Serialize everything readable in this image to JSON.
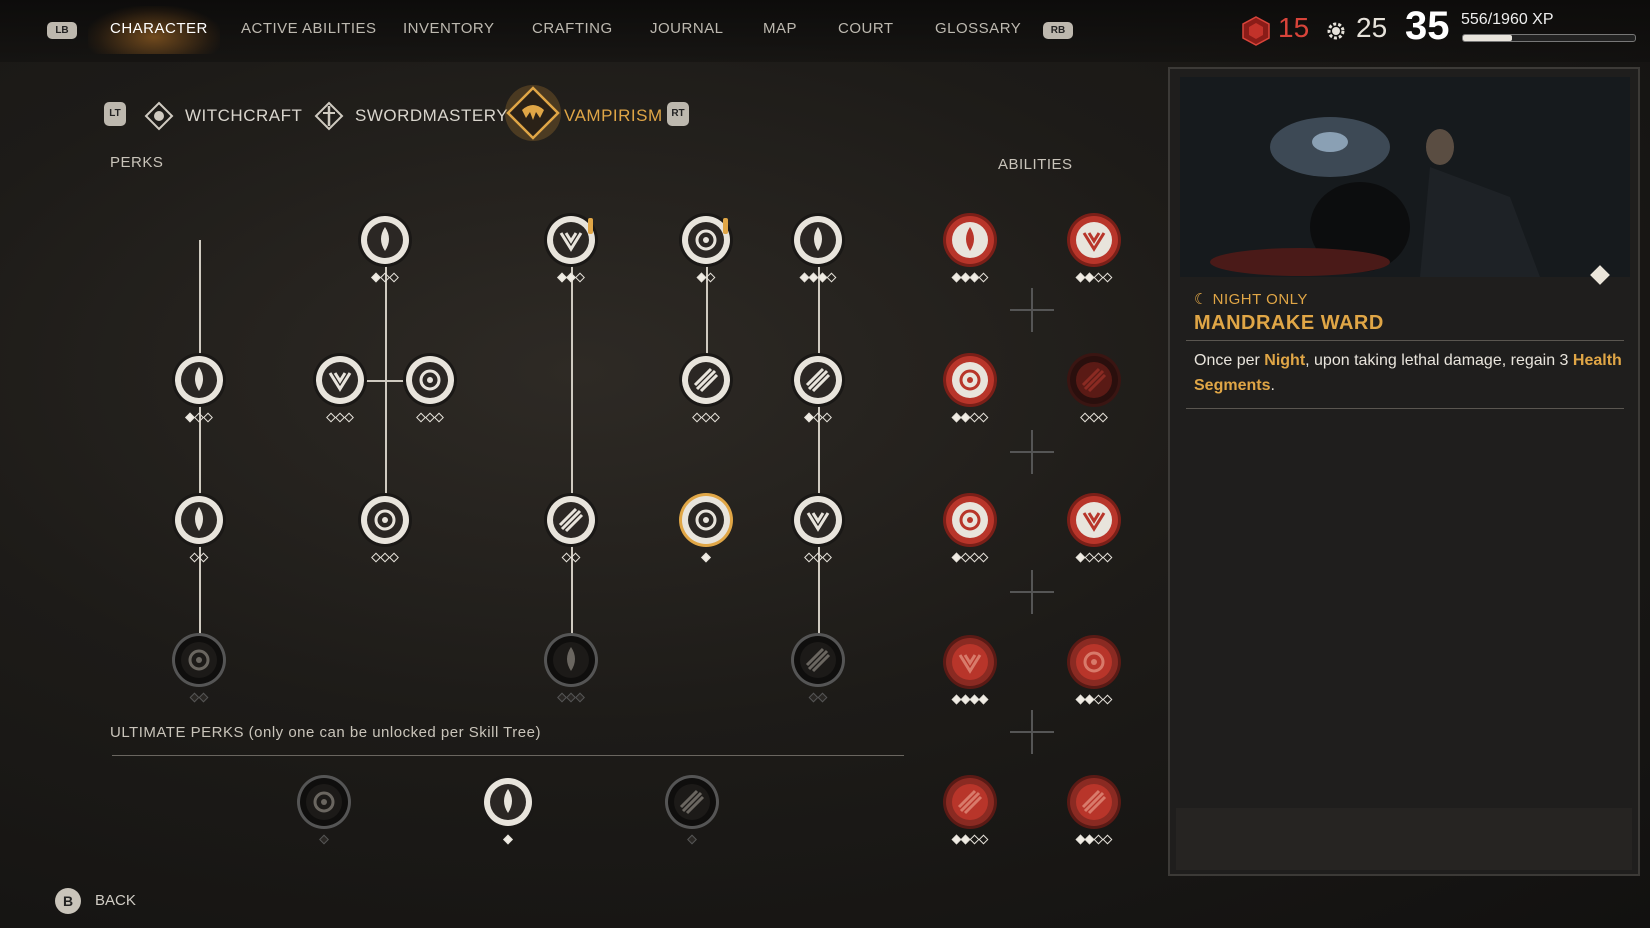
{
  "top_nav": {
    "left_button": "LB",
    "right_button": "RB",
    "tabs": [
      "CHARACTER",
      "ACTIVE ABILITIES",
      "INVENTORY",
      "CRAFTING",
      "JOURNAL",
      "MAP",
      "COURT",
      "GLOSSARY"
    ],
    "active_tab": "CHARACTER"
  },
  "status": {
    "red_count": "15",
    "gear_count": "25",
    "level": "35",
    "xp": "556/1960 XP",
    "xp_fraction": 0.284
  },
  "skill_trees": {
    "left_button": "LT",
    "right_button": "RT",
    "tabs": [
      "WITCHCRAFT",
      "SWORDMASTERY",
      "VAMPIRISM"
    ],
    "active": "VAMPIRISM"
  },
  "sections": {
    "perks": "PERKS",
    "abilities": "ABILITIES",
    "ultimate": "ULTIMATE PERKS (only one can be unlocked per Skill Tree)"
  },
  "detail": {
    "tag": "☾ NIGHT ONLY",
    "title": "MANDRAKE WARD",
    "desc_parts": [
      "Once per ",
      "Night",
      ", upon taking lethal damage, regain 3 ",
      "Health Segments",
      "."
    ]
  },
  "back": {
    "button": "B",
    "label": "BACK"
  },
  "colors": {
    "accent": "#e0a646",
    "red": "#d8443a",
    "ability_red": "#b8352a"
  }
}
